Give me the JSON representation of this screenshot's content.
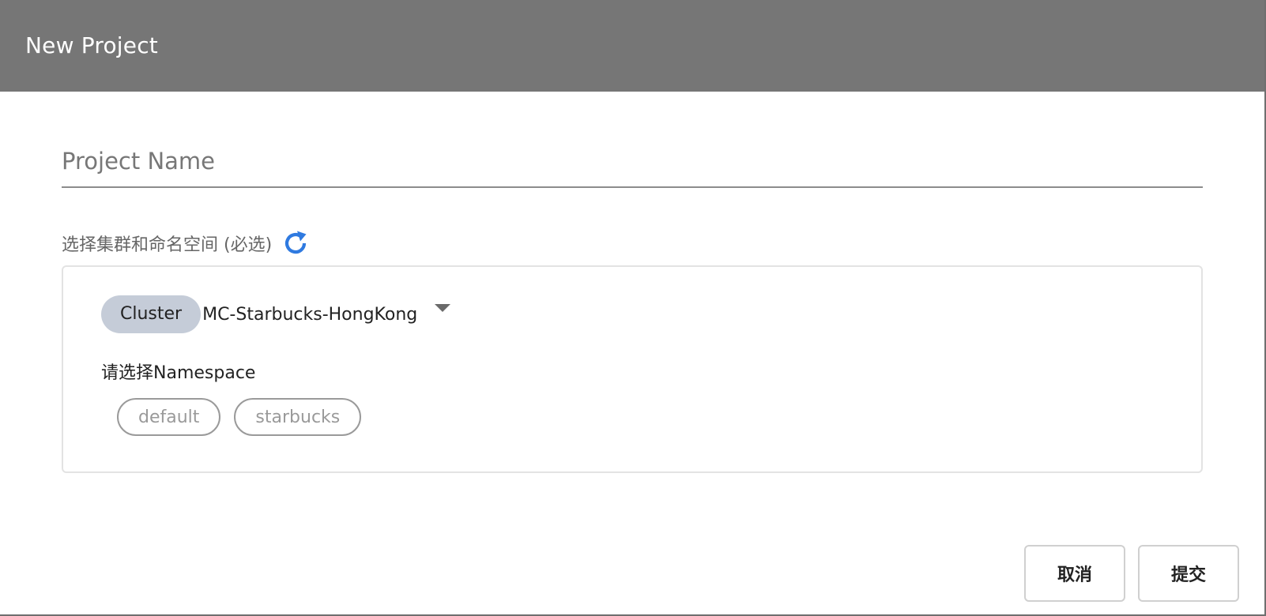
{
  "dialog": {
    "title": "New Project"
  },
  "form": {
    "project_name": {
      "placeholder": "Project Name",
      "value": ""
    },
    "cluster_section": {
      "label": "选择集群和命名空间 (必选)",
      "refresh_icon": "refresh-icon",
      "cluster": {
        "badge": "Cluster",
        "selected": "MC-Starbucks-HongKong",
        "dropdown_icon": "caret-down-icon"
      },
      "namespace": {
        "label": "请选择Namespace",
        "options": [
          "default",
          "starbucks"
        ]
      }
    }
  },
  "footer": {
    "cancel_label": "取消",
    "submit_label": "提交"
  },
  "colors": {
    "header_bg": "#767676",
    "accent_blue": "#2f7ae0",
    "badge_bg": "#c5ccd8"
  }
}
